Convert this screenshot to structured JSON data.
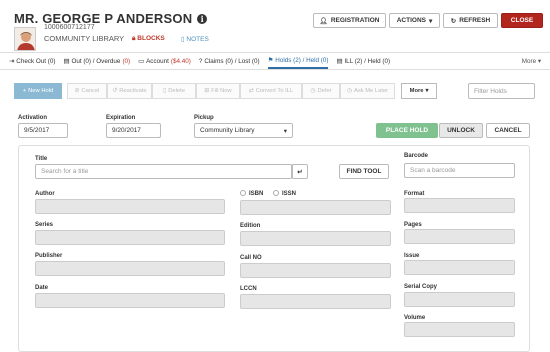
{
  "patron": {
    "name": "MR. GEORGE P ANDERSON",
    "barcode": "1000600712177",
    "library": "COMMUNITY LIBRARY",
    "blocks": "BLOCKS",
    "notes": "NOTES"
  },
  "header_buttons": {
    "registration": "REGISTRATION",
    "actions": "ACTIONS",
    "refresh": "REFRESH",
    "close": "CLOSE"
  },
  "tabs": [
    {
      "label": "Check Out (0)"
    },
    {
      "label": "Out (0) / Overdue ",
      "extra": "(0)"
    },
    {
      "label": "Account ",
      "extra": "($4.40)"
    },
    {
      "label": "Claims (0) / Lost (0)"
    },
    {
      "label": "Holds (2) / Held (0)"
    },
    {
      "label": "ILL (2) / Held (0)"
    }
  ],
  "more_tab": "More",
  "toolbar": {
    "new_hold": "New Hold",
    "cancel": "Cancel",
    "reactivate": "Reactivate",
    "delete": "Delete",
    "fill_now": "Fill Now",
    "convert": "Convert To ILL",
    "defer": "Defer",
    "ask_later": "Ask Me Later",
    "more": "More",
    "filter_placeholder": "Filter Holds"
  },
  "form": {
    "activation_label": "Activation",
    "activation": "9/5/2017",
    "expiration_label": "Expiration",
    "expiration": "9/20/2017",
    "pickup_label": "Pickup",
    "pickup": "Community Library",
    "place_hold": "PLACE HOLD",
    "unlock": "UNLOCK",
    "cancel": "CANCEL"
  },
  "panel": {
    "title_label": "Title",
    "title_placeholder": "Search for a title",
    "find_tool": "FIND TOOL",
    "barcode_label": "Barcode",
    "barcode_placeholder": "Scan a barcode",
    "author_label": "Author",
    "isbn_label": "ISBN",
    "issn_label": "ISSN",
    "format_label": "Format",
    "series_label": "Series",
    "edition_label": "Edition",
    "pages_label": "Pages",
    "publisher_label": "Publisher",
    "callno_label": "Call NO",
    "issue_label": "Issue",
    "date_label": "Date",
    "lccn_label": "LCCN",
    "serial_label": "Serial Copy",
    "volume_label": "Volume"
  }
}
